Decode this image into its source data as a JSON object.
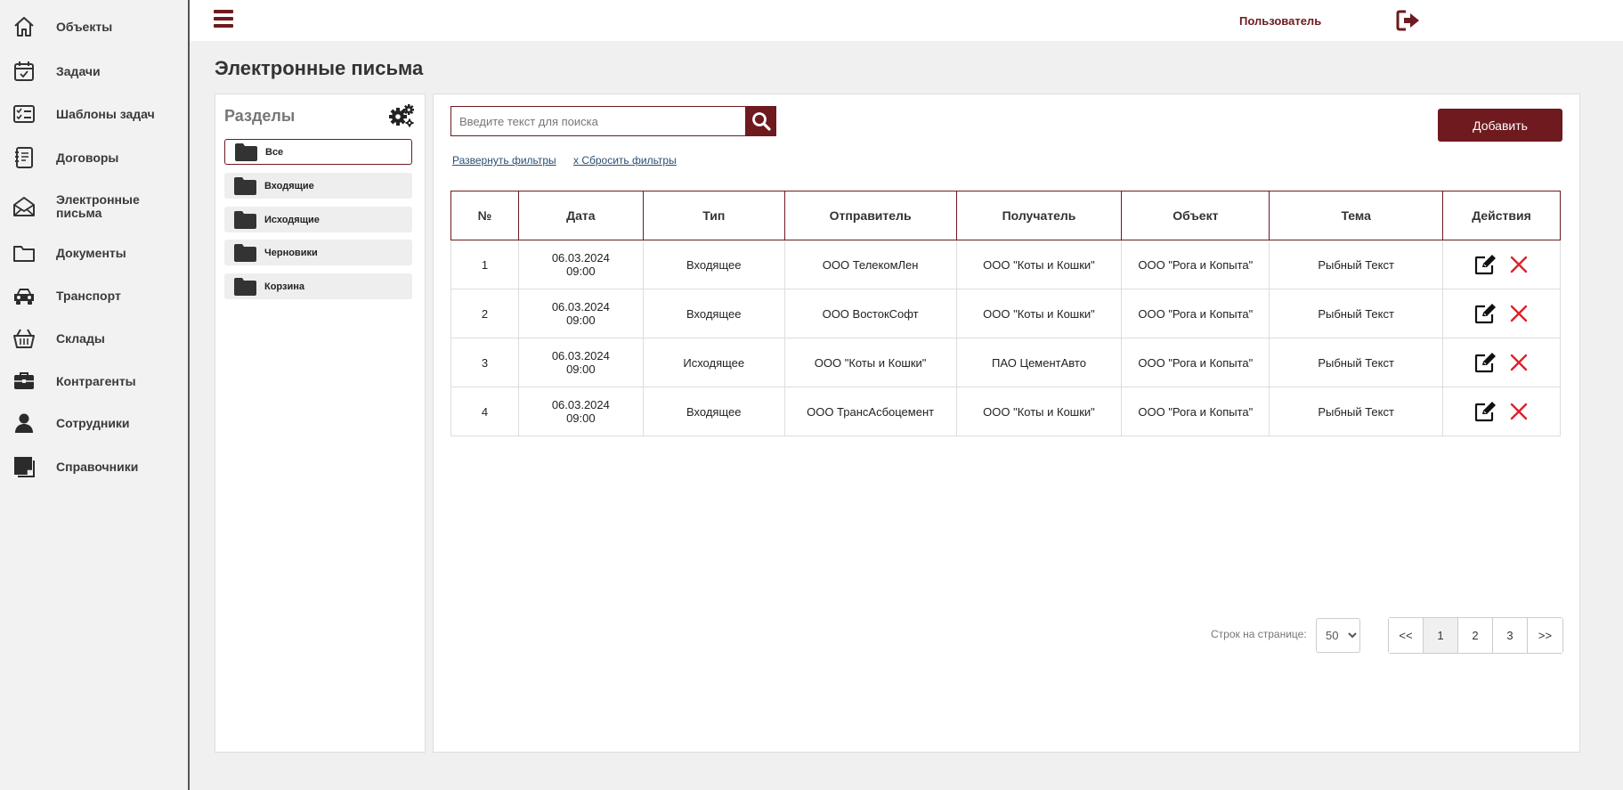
{
  "nav": [
    {
      "label": "Объекты",
      "icon": "home-icon"
    },
    {
      "label": "Задачи",
      "icon": "calendar-check-icon"
    },
    {
      "label": "Шаблоны задач",
      "icon": "checklist-icon"
    },
    {
      "label": "Договоры",
      "icon": "contract-book-icon"
    },
    {
      "label": "Электронные письма",
      "icon": "envelope-icon"
    },
    {
      "label": "Документы",
      "icon": "folder-outline-icon"
    },
    {
      "label": "Транспорт",
      "icon": "car-icon"
    },
    {
      "label": "Склады",
      "icon": "basket-icon"
    },
    {
      "label": "Контрагенты",
      "icon": "briefcase-icon"
    },
    {
      "label": "Сотрудники",
      "icon": "person-icon"
    },
    {
      "label": "Справочники",
      "icon": "note-icon"
    }
  ],
  "header": {
    "user_label": "Пользователь",
    "page_title": "Электронные письма"
  },
  "sections": {
    "title": "Разделы",
    "items": [
      "Все",
      "Входящие",
      "Исходящие",
      "Черновики",
      "Корзина"
    ],
    "active_index": 0
  },
  "toolbar": {
    "search_placeholder": "Введите текст для поиска",
    "add_label": "Добавить",
    "expand_filters": "Развернуть фильтры",
    "reset_filters": "x Сбросить фильтры"
  },
  "table": {
    "columns": [
      "№",
      "Дата",
      "Тип",
      "Отправитель",
      "Получатель",
      "Объект",
      "Тема",
      "Действия"
    ],
    "rows": [
      {
        "num": "1",
        "date": "06.03.2024",
        "time": "09:00",
        "type": "Входящее",
        "sender": "ООО ТелекомЛен",
        "recipient": "ООО \"Коты и Кошки\"",
        "object": "ООО \"Рога и Копыта\"",
        "subject": "Рыбный Текст"
      },
      {
        "num": "2",
        "date": "06.03.2024",
        "time": "09:00",
        "type": "Входящее",
        "sender": "ООО ВостокСофт",
        "recipient": "ООО \"Коты и Кошки\"",
        "object": "ООО \"Рога и Копыта\"",
        "subject": "Рыбный Текст"
      },
      {
        "num": "3",
        "date": "06.03.2024",
        "time": "09:00",
        "type": "Исходящее",
        "sender": "ООО \"Коты и Кошки\"",
        "recipient": "ПАО ЦементАвто",
        "object": "ООО \"Рога и Копыта\"",
        "subject": "Рыбный Текст"
      },
      {
        "num": "4",
        "date": "06.03.2024",
        "time": "09:00",
        "type": "Входящее",
        "sender": "ООО ТрансАсбоцемент",
        "recipient": "ООО \"Коты и Кошки\"",
        "object": "ООО \"Рога и Копыта\"",
        "subject": "Рыбный Текст"
      }
    ]
  },
  "pagination": {
    "rows_label": "Строк на странице:",
    "rows_value": "50",
    "pages": [
      "<<",
      "1",
      "2",
      "3",
      ">>"
    ],
    "current": "1"
  },
  "colors": {
    "accent": "#6e1a1e",
    "delete": "#e0202a"
  }
}
